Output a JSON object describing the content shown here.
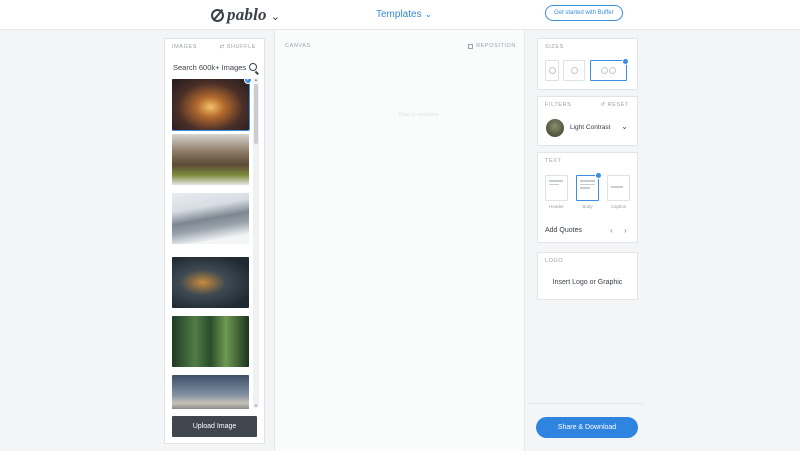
{
  "header": {
    "logo_text": "pablo",
    "logo_chevron_icon": "chevron-down-icon",
    "templates_label": "Templates",
    "cta_label": "Get started with Buffer"
  },
  "images_panel": {
    "title": "IMAGES",
    "shuffle_label": "SHUFFLE",
    "search_placeholder": "Search 600k+ Images",
    "search_icon": "search-icon",
    "upload_label": "Upload Image",
    "thumbnails": [
      {
        "name": "night-road-lights",
        "selected": true
      },
      {
        "name": "forest-path-snow",
        "selected": false
      },
      {
        "name": "snowy-hillside-trees",
        "selected": false
      },
      {
        "name": "city-traffic-night",
        "selected": false
      },
      {
        "name": "green-forest",
        "selected": false
      },
      {
        "name": "sea-sunset",
        "selected": false
      }
    ]
  },
  "canvas": {
    "label": "CANVAS",
    "reposition_label": "REPOSITION",
    "hint": "Drag to reposition"
  },
  "sizes": {
    "title": "SIZES",
    "options": [
      {
        "name": "square",
        "selected": false
      },
      {
        "name": "portrait",
        "selected": false
      },
      {
        "name": "landscape",
        "selected": true
      }
    ]
  },
  "filters": {
    "title": "FILTERS",
    "reset_label": "RESET",
    "current": "Light Contrast"
  },
  "text": {
    "title": "TEXT",
    "options": [
      {
        "label": "Header",
        "selected": false
      },
      {
        "label": "Body",
        "selected": true
      },
      {
        "label": "Caption",
        "selected": false
      }
    ],
    "add_quotes_label": "Add Quotes",
    "prev_icon": "chevron-left-icon",
    "next_icon": "chevron-right-icon"
  },
  "logo_panel": {
    "title": "LOGO",
    "insert_label": "Insert Logo or Graphic"
  },
  "share": {
    "label": "Share & Download"
  },
  "colors": {
    "accent": "#3b8fe0",
    "share_button": "#2f84e0",
    "upload_button": "#40464e"
  }
}
